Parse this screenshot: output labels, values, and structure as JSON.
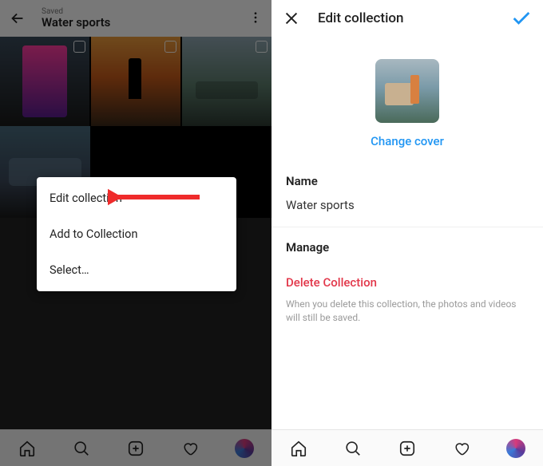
{
  "left": {
    "header": {
      "saved": "Saved",
      "title": "Water sports"
    },
    "popup": {
      "edit": "Edit collection",
      "add": "Add to Collection",
      "select": "Select…"
    }
  },
  "right": {
    "title": "Edit collection",
    "change_cover": "Change cover",
    "name_label": "Name",
    "name_value": "Water sports",
    "manage_label": "Manage",
    "delete": "Delete Collection",
    "hint": "When you delete this collection, the photos and videos will still be saved."
  }
}
